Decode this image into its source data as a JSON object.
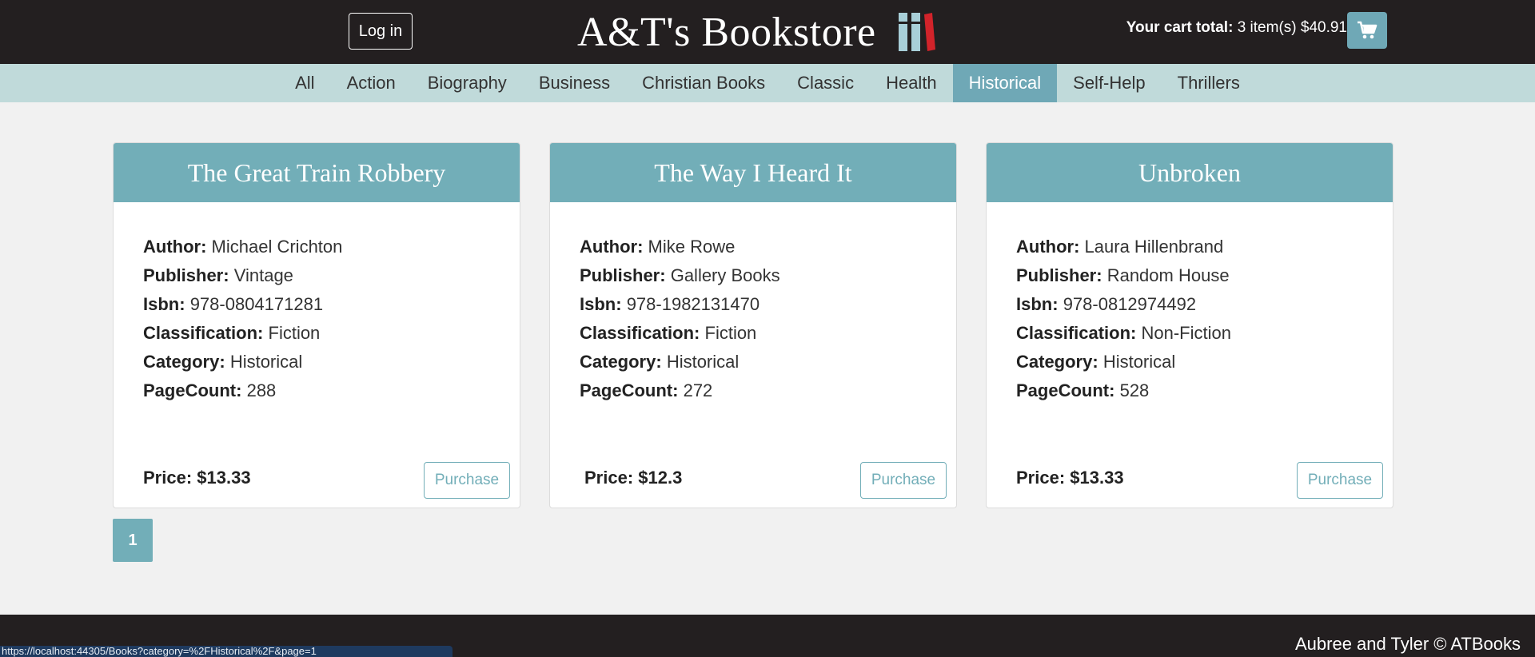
{
  "header": {
    "login_label": "Log in",
    "title": "A&T's Bookstore",
    "cart_label": "Your cart total:",
    "cart_value": "3 item(s) $40.91",
    "cart_icon": "shopping-cart-icon",
    "logo_icon": "books-logo-icon",
    "logo_colors": [
      "#a8cfd8",
      "#a8cfd8",
      "#d2232a"
    ]
  },
  "categories": [
    "All",
    "Action",
    "Biography",
    "Business",
    "Christian Books",
    "Classic",
    "Health",
    "Historical",
    "Self-Help",
    "Thrillers"
  ],
  "active_category": "Historical",
  "field_labels": {
    "author": "Author:",
    "publisher": "Publisher:",
    "isbn": "Isbn:",
    "classification": "Classification:",
    "category": "Category:",
    "pagecount": "PageCount:",
    "price": "Price:"
  },
  "purchase_label": "Purchase",
  "books": [
    {
      "title": "The Great Train Robbery",
      "author": "Michael Crichton",
      "publisher": "Vintage",
      "isbn": "978-0804171281",
      "classification": "Fiction",
      "category": "Historical",
      "pagecount": "288",
      "price": "$13.33"
    },
    {
      "title": "The Way I Heard It",
      "author": "Mike Rowe",
      "publisher": "Gallery Books",
      "isbn": "978-1982131470",
      "classification": "Fiction",
      "category": "Historical",
      "pagecount": "272",
      "price": "$12.3"
    },
    {
      "title": "Unbroken",
      "author": "Laura Hillenbrand",
      "publisher": "Random House",
      "isbn": "978-0812974492",
      "classification": "Non-Fiction",
      "category": "Historical",
      "pagecount": "528",
      "price": "$13.33"
    }
  ],
  "pagination": {
    "current": "1"
  },
  "footer": {
    "text": "Aubree and Tyler © ATBooks"
  },
  "status_bar": {
    "url": "https://localhost:44305/Books?category=%2FHistorical%2F&page=1"
  },
  "colors": {
    "header_bg": "#231f20",
    "nav_bg": "#c0dada",
    "accent": "#72aeb8",
    "page_bg": "#f1f1f1"
  }
}
